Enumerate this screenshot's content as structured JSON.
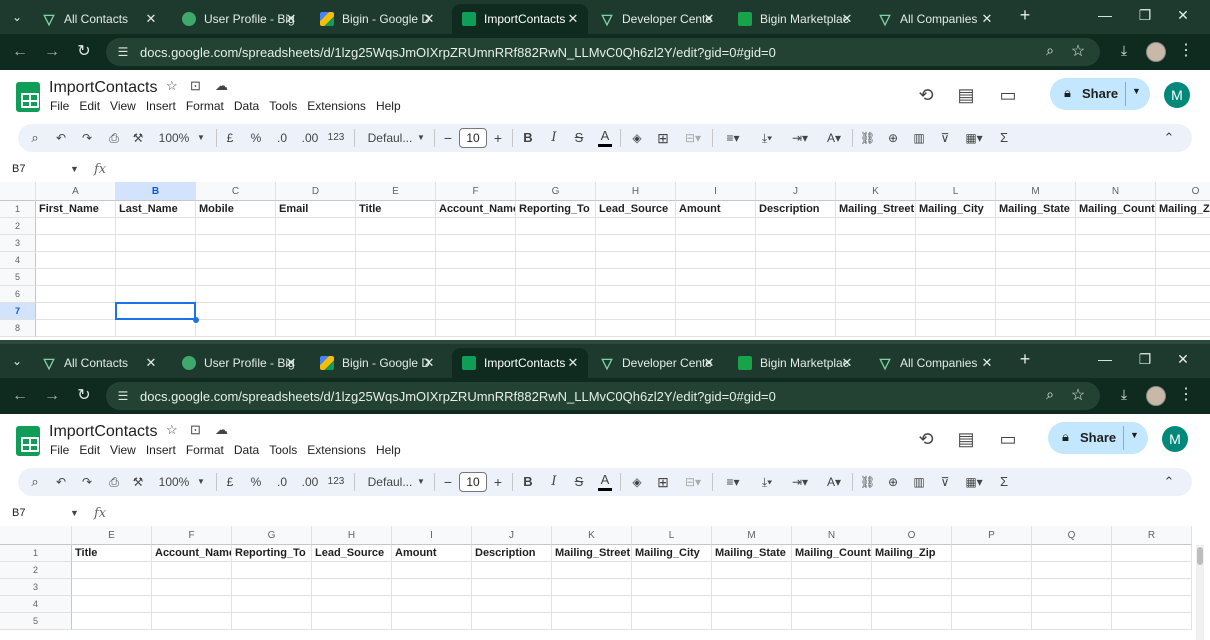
{
  "browser": {
    "tabs": [
      {
        "title": "All Contacts",
        "icon": "vee-icon"
      },
      {
        "title": "User Profile - Big",
        "icon": "bigin-icon"
      },
      {
        "title": "Bigin - Google D",
        "icon": "drive-icon"
      },
      {
        "title": "ImportContacts",
        "icon": "sheets-icon",
        "active": true
      },
      {
        "title": "Developer Cente",
        "icon": "vee-icon"
      },
      {
        "title": "Bigin Marketplac",
        "icon": "marketplace-icon"
      },
      {
        "title": "All Companies",
        "icon": "vee-icon"
      }
    ],
    "close_glyph": "✕",
    "new_tab_glyph": "+",
    "url": "docs.google.com/spreadsheets/d/1lzg25WqsJmOIXrpZRUmnRRf882RwN_LLMvC0Qh6zl2Y/edit?gid=0#gid=0"
  },
  "sheet": {
    "title": "ImportContacts",
    "menu": [
      "File",
      "Edit",
      "View",
      "Insert",
      "Format",
      "Data",
      "Tools",
      "Extensions",
      "Help"
    ],
    "share_label": "Share",
    "avatar_letter": "M",
    "toolbar": {
      "zoom": "100%",
      "currency": "£",
      "percent": "%",
      "dec_decrease": ".0",
      "dec_increase": ".00",
      "number_format": "123",
      "font": "Defaul...",
      "font_size": "10",
      "bold": "B",
      "italic": "I",
      "strike": "S",
      "text_color": "A",
      "functions": "Σ"
    },
    "name_box": "B7",
    "fx_label": "fx",
    "accent_color": "#1a73e8"
  },
  "view1": {
    "columns": [
      "A",
      "B",
      "C",
      "D",
      "E",
      "F",
      "G",
      "H",
      "I",
      "J",
      "K",
      "L",
      "M",
      "N",
      "O"
    ],
    "rows": [
      "1",
      "2",
      "3",
      "4",
      "5",
      "6",
      "7",
      "8"
    ],
    "headers": [
      "First_Name",
      "Last_Name",
      "Mobile",
      "Email",
      "Title",
      "Account_Name",
      "Reporting_To",
      "Lead_Source",
      "Amount",
      "Description",
      "Mailing_Street",
      "Mailing_City",
      "Mailing_State",
      "Mailing_Country",
      "Mailing_Zip"
    ],
    "selected_column": "B",
    "selected_row": "7"
  },
  "view2": {
    "columns": [
      "E",
      "F",
      "G",
      "H",
      "I",
      "J",
      "K",
      "L",
      "M",
      "N",
      "O",
      "P",
      "Q",
      "R"
    ],
    "rows": [
      "1",
      "2",
      "3",
      "4",
      "5"
    ],
    "headers": [
      "Title",
      "Account_Name",
      "Reporting_To",
      "Lead_Source",
      "Amount",
      "Description",
      "Mailing_Street",
      "Mailing_City",
      "Mailing_State",
      "Mailing_Country",
      "Mailing_Zip",
      "",
      "",
      ""
    ]
  }
}
